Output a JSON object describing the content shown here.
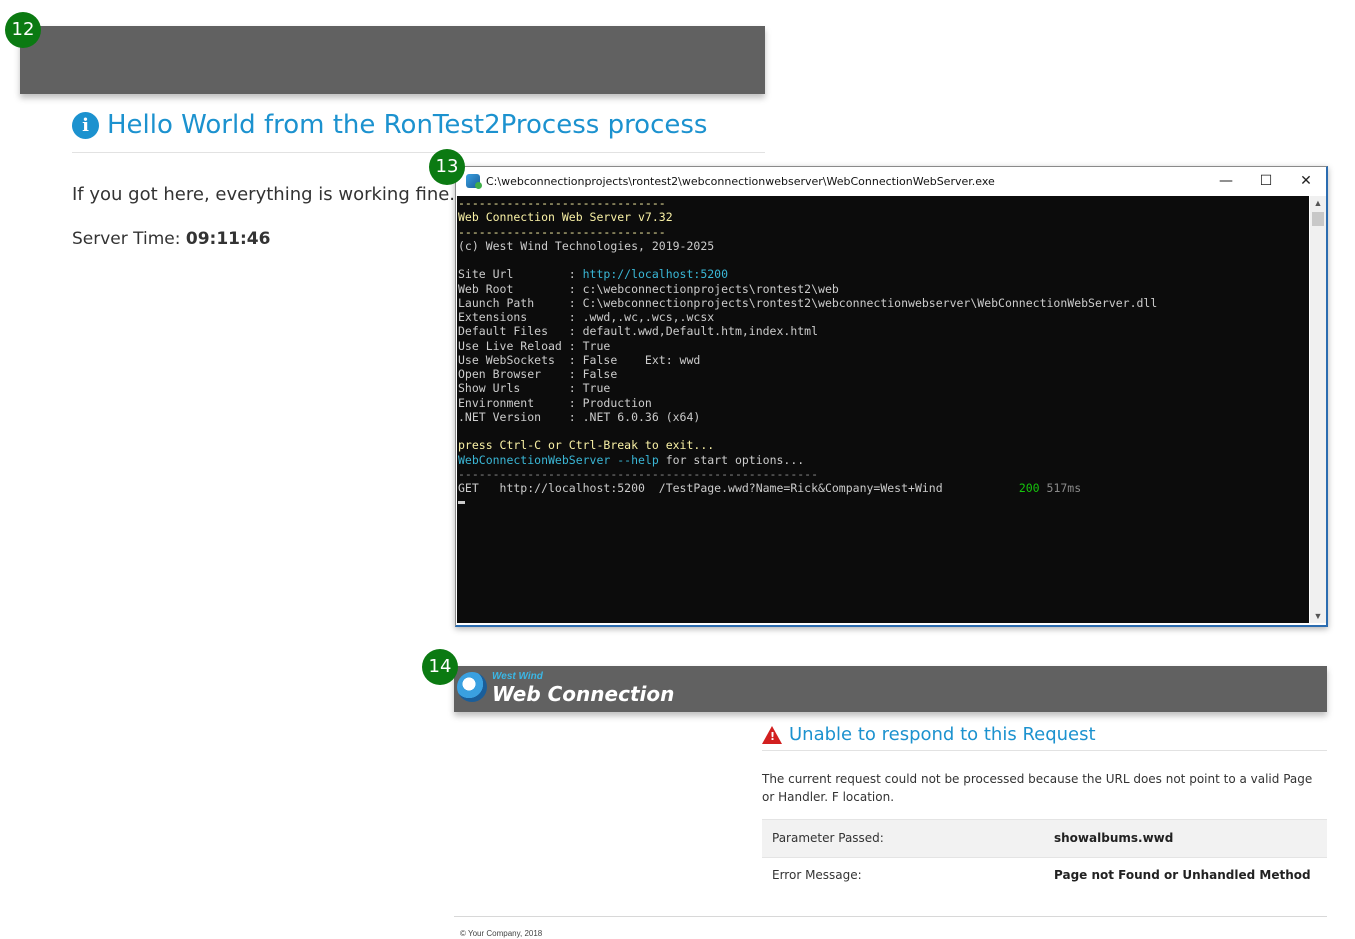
{
  "badges": {
    "b12": "12",
    "b13": "13",
    "b14": "14"
  },
  "panel12": {
    "title": "Hello World from the RonTest2Process process",
    "message": "If you got here, everything is working fine.",
    "server_time_label": "Server Time:",
    "server_time_value": "09:11:46",
    "info_icon_glyph": "i"
  },
  "console_window": {
    "title": "C:\\webconnectionprojects\\rontest2\\webconnectionwebserver\\WebConnectionWebServer.exe",
    "minimize": "—",
    "maximize": "☐",
    "close": "✕",
    "lines": {
      "sep1": "------------------------------",
      "server_name": "Web Connection Web Server v7.32",
      "sep2": "------------------------------",
      "copyright": "(c) West Wind Technologies, 2019-2025",
      "site_url_label": "Site Url        : ",
      "site_url_value": "http://localhost:5200",
      "web_root": "Web Root        : c:\\webconnectionprojects\\rontest2\\web",
      "launch_path": "Launch Path     : C:\\webconnectionprojects\\rontest2\\webconnectionwebserver\\WebConnectionWebServer.dll",
      "extensions": "Extensions      : .wwd,.wc,.wcs,.wcsx",
      "default_files": "Default Files   : default.wwd,Default.htm,index.html",
      "live_reload": "Use Live Reload : True",
      "websockets": "Use WebSockets  : False    Ext: wwd",
      "open_browser": "Open Browser    : False",
      "show_urls": "Show Urls       : True",
      "environment": "Environment     : Production",
      "net_version": ".NET Version    : .NET 6.0.36 (x64)",
      "exit_hint": "press Ctrl-C or Ctrl-Break to exit...",
      "help_cmd": "WebConnectionWebServer --help",
      "help_rest": " for start options...",
      "sep3": "----------------------------------------------------",
      "request": "GET   http://localhost:5200  /TestPage.wwd?Name=Rick&Company=West+Wind           ",
      "status_code": "200",
      "elapsed": " 517ms"
    }
  },
  "panel14": {
    "logo_small": "West Wind",
    "logo_main": "Web Connection",
    "error_title": "Unable to respond to this Request",
    "description": "The current request could not be processed because the URL does not point to a valid Page or Handler. F location.",
    "rows": [
      {
        "label": "Parameter Passed:",
        "value": "showalbums.wwd"
      },
      {
        "label": "Error Message:",
        "value": "Page not Found or Unhandled Method"
      }
    ],
    "footer": "© Your Company, 2018"
  },
  "colors": {
    "accent_blue": "#1c92cf",
    "header_gray": "#616161",
    "badge_green": "#0b7a12",
    "console_bg": "#0c0c0c",
    "error_red": "#d21f1f"
  }
}
